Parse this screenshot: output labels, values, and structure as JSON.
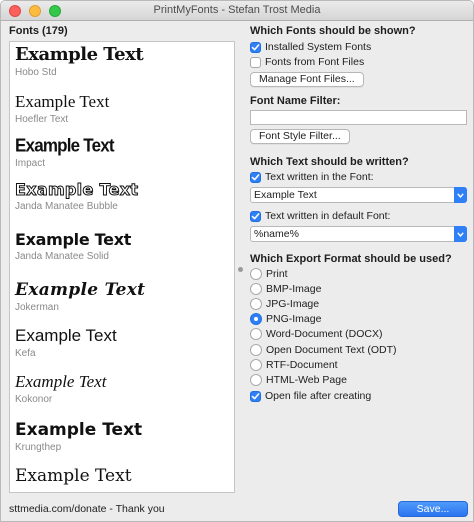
{
  "window": {
    "title": "PrintMyFonts - Stefan Trost Media"
  },
  "font_list": {
    "heading": "Fonts (179)",
    "items": [
      {
        "sample": "Example Text",
        "name": "Hobo Std"
      },
      {
        "sample": "Example Text",
        "name": "Hoefler Text"
      },
      {
        "sample": "Example Text",
        "name": "Impact"
      },
      {
        "sample": "Example Text",
        "name": "Janda Manatee Bubble"
      },
      {
        "sample": "Example Text",
        "name": "Janda Manatee Solid"
      },
      {
        "sample": "Example Text",
        "name": "Jokerman"
      },
      {
        "sample": "Example Text",
        "name": "Kefa"
      },
      {
        "sample": "Example Text",
        "name": "Kokonor"
      },
      {
        "sample": "Example Text",
        "name": "Krungthep"
      },
      {
        "sample": "Example Text",
        "name": ""
      }
    ]
  },
  "fonts_shown": {
    "heading": "Which Fonts should be shown?",
    "installed_label": "Installed System Fonts",
    "installed_checked": true,
    "from_files_label": "Fonts from Font Files",
    "from_files_checked": false,
    "manage_button": "Manage Font Files..."
  },
  "filter": {
    "heading": "Font Name Filter:",
    "value": "",
    "style_button": "Font Style Filter..."
  },
  "text": {
    "heading": "Which Text should be written?",
    "in_font_label": "Text written in the Font:",
    "in_font_checked": true,
    "in_font_value": "Example Text",
    "default_label": "Text written in default Font:",
    "default_checked": true,
    "default_value": "%name%"
  },
  "export": {
    "heading": "Which Export Format should be used?",
    "options": [
      "Print",
      "BMP-Image",
      "JPG-Image",
      "PNG-Image",
      "Word-Document (DOCX)",
      "Open Document Text (ODT)",
      "RTF-Document",
      "HTML-Web Page"
    ],
    "selected": "PNG-Image",
    "open_after_label": "Open file after creating",
    "open_after_checked": true
  },
  "footer": {
    "donate_text": "sttmedia.com/donate - Thank you",
    "save_button": "Save..."
  },
  "colors": {
    "accent": "#2f7ff6",
    "window_bg": "#ececec"
  }
}
